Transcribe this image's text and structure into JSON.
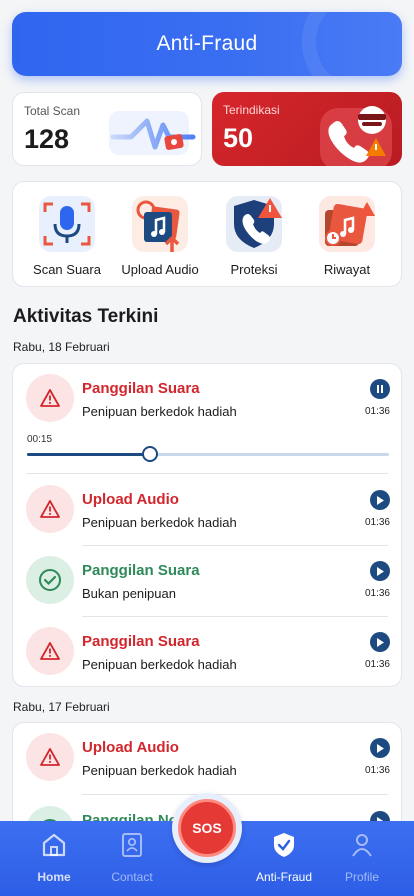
{
  "header": {
    "title": "Anti-Fraud"
  },
  "stats": {
    "scan": {
      "label": "Total Scan",
      "value": "128"
    },
    "fraud": {
      "label": "Terindikasi",
      "value": "50"
    }
  },
  "quick_actions": [
    {
      "label": "Scan Suara",
      "icon": "microphone-scan-icon"
    },
    {
      "label": "Upload Audio",
      "icon": "upload-audio-icon"
    },
    {
      "label": "Proteksi",
      "icon": "shield-phone-icon"
    },
    {
      "label": "Riwayat",
      "icon": "history-icon"
    }
  ],
  "activity": {
    "title": "Aktivitas Terkini",
    "groups": [
      {
        "date": "Rabu, 18 Februari",
        "player": {
          "elapsed": "00:15",
          "progress": 0.34
        },
        "items": [
          {
            "title": "Panggilan Suara",
            "subtitle": "Penipuan berkedok hadiah",
            "time": "01:36",
            "status": "fraud",
            "playing": true
          },
          {
            "title": "Upload Audio",
            "subtitle": "Penipuan berkedok hadiah",
            "time": "01:36",
            "status": "fraud",
            "playing": false
          },
          {
            "title": "Panggilan Suara",
            "subtitle": "Bukan penipuan",
            "time": "01:36",
            "status": "safe",
            "playing": false
          },
          {
            "title": "Panggilan Suara",
            "subtitle": "Penipuan berkedok hadiah",
            "time": "01:36",
            "status": "fraud",
            "playing": false
          }
        ]
      },
      {
        "date": "Rabu, 17 Februari",
        "items": [
          {
            "title": "Upload Audio",
            "subtitle": "Penipuan berkedok hadiah",
            "time": "01:36",
            "status": "fraud",
            "playing": false
          },
          {
            "title": "Panggilan No",
            "subtitle": "",
            "time": "",
            "status": "safe",
            "playing": false
          }
        ]
      }
    ]
  },
  "nav": {
    "items": [
      {
        "label": "Home",
        "icon": "home-icon"
      },
      {
        "label": "Contact",
        "icon": "contact-book-icon"
      },
      {
        "label": "Anti-Fraud",
        "icon": "shield-check-icon"
      },
      {
        "label": "Profile",
        "icon": "user-icon"
      }
    ],
    "sos_label": "SOS"
  },
  "colors": {
    "primary": "#2f66f0",
    "danger": "#d2262d",
    "safe": "#2f8a5a",
    "play_button": "#1d4a80"
  }
}
